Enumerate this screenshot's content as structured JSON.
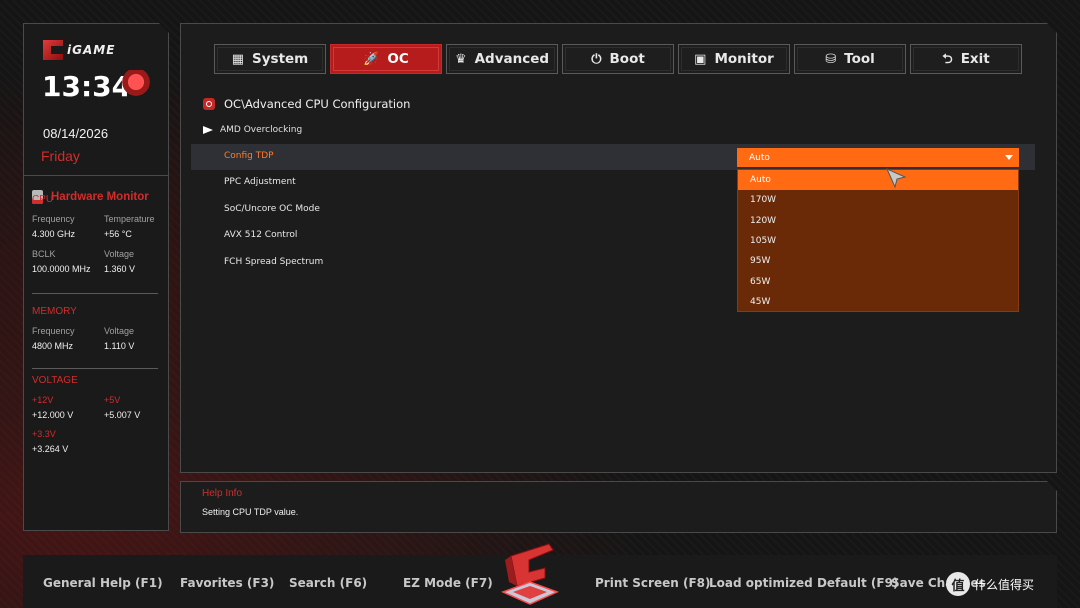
{
  "brand": {
    "logo_text": "iGAME"
  },
  "clock": {
    "time": "13:34",
    "date": "08/14/2026",
    "day": "Friday"
  },
  "hardware_monitor": {
    "title": "Hardware Monitor",
    "cpu": {
      "title": "CPU",
      "frequency_label": "Frequency",
      "frequency": "4.300 GHz",
      "temperature_label": "Temperature",
      "temperature": "+56 °C",
      "bclk_label": "BCLK",
      "bclk": "100.0000 MHz",
      "voltage_label": "Voltage",
      "voltage": "1.360 V"
    },
    "memory": {
      "title": "MEMORY",
      "frequency_label": "Frequency",
      "frequency": "4800 MHz",
      "voltage_label": "Voltage",
      "voltage": "1.110 V"
    },
    "voltage": {
      "title": "VOLTAGE",
      "v12_label": "+12V",
      "v12": "+12.000 V",
      "v5_label": "+5V",
      "v5": "+5.007 V",
      "v33_label": "+3.3V",
      "v33": "+3.264 V"
    }
  },
  "tabs": [
    {
      "label": "System",
      "icon": "grid-icon",
      "glyph": "▦",
      "active": false
    },
    {
      "label": "OC",
      "icon": "rocket-icon",
      "glyph": "🚀",
      "active": true
    },
    {
      "label": "Advanced",
      "icon": "crown-icon",
      "glyph": "♛",
      "active": false
    },
    {
      "label": "Boot",
      "icon": "power-icon",
      "glyph": "⏻",
      "active": false
    },
    {
      "label": "Monitor",
      "icon": "monitor-icon",
      "glyph": "▣",
      "active": false
    },
    {
      "label": "Tool",
      "icon": "toolbox-icon",
      "glyph": "⛁",
      "active": false
    },
    {
      "label": "Exit",
      "icon": "back-arrow-icon",
      "glyph": "⮌",
      "active": false
    }
  ],
  "breadcrumb": "OC\\Advanced CPU Configuration",
  "submenu": "AMD Overclocking",
  "settings": [
    {
      "label": "Config TDP",
      "selected": true
    },
    {
      "label": "PPC Adjustment",
      "selected": false
    },
    {
      "label": "SoC/Uncore OC Mode",
      "selected": false
    },
    {
      "label": "AVX 512 Control",
      "selected": false
    },
    {
      "label": "FCH Spread Spectrum",
      "selected": false
    }
  ],
  "dropdown": {
    "value": "Auto",
    "options": [
      "Auto",
      "170W",
      "120W",
      "105W",
      "95W",
      "65W",
      "45W"
    ],
    "highlighted_index": 0
  },
  "help": {
    "title": "Help Info",
    "text": "Setting CPU TDP value."
  },
  "footer": {
    "general_help": "General Help (F1)",
    "favorites": "Favorites (F3)",
    "search": "Search (F6)",
    "ez_mode": "EZ Mode (F7)",
    "print_screen": "Print Screen (F8)",
    "load_default": "Load optimized Default (F9)",
    "save_changes": "Save Changes"
  },
  "watermark": {
    "glyph": "值",
    "text": "什么值得买"
  },
  "colors": {
    "accent_red": "#b71c1c",
    "accent_orange": "#ff6a12",
    "dropdown_bg": "#6a2a08",
    "panel_bg": "#1c1c1c"
  }
}
